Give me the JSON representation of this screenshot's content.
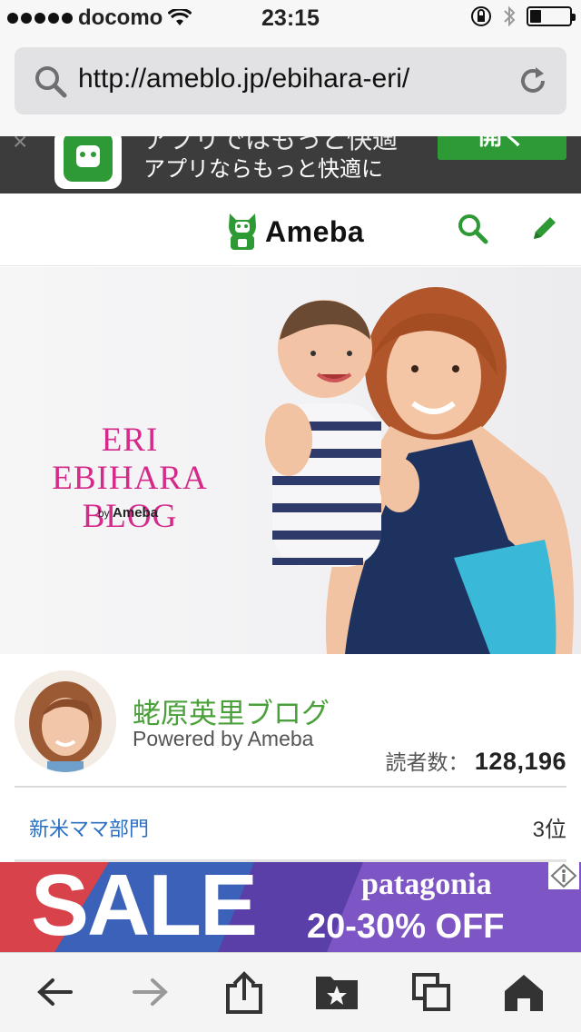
{
  "status_bar": {
    "carrier": "docomo",
    "time": "23:15",
    "icons": [
      "signal-dots",
      "wifi-icon",
      "orientation-lock-icon",
      "bluetooth-icon",
      "battery-icon"
    ]
  },
  "browser": {
    "url": "http://ameblo.jp/ebihara-eri/"
  },
  "app_banner": {
    "line1": "アプリではもっと快適",
    "line2": "アプリならもっと快適に",
    "open_label": "開く"
  },
  "header": {
    "logo_text": "Ameba",
    "brand_color": "#2e9a36"
  },
  "hero": {
    "title_line1": "ERI EBIHARA",
    "title_line2": "BLOG",
    "by_prefix": "by",
    "by_brand": "Ameba",
    "title_color": "#d42a8a"
  },
  "profile": {
    "blog_title": "蛯原英里ブログ",
    "powered": "Powered by Ameba",
    "readers_label": "読者数：",
    "readers_count": "128,196"
  },
  "ranking": {
    "category": "新米ママ部門",
    "rank": "3位"
  },
  "ad": {
    "sale": "SALE",
    "brand": "patagonia",
    "discount": "20-30% OFF"
  },
  "toolbar": {
    "items": [
      "back-icon",
      "forward-icon",
      "share-icon",
      "bookmarks-icon",
      "tabs-icon",
      "home-icon"
    ]
  }
}
